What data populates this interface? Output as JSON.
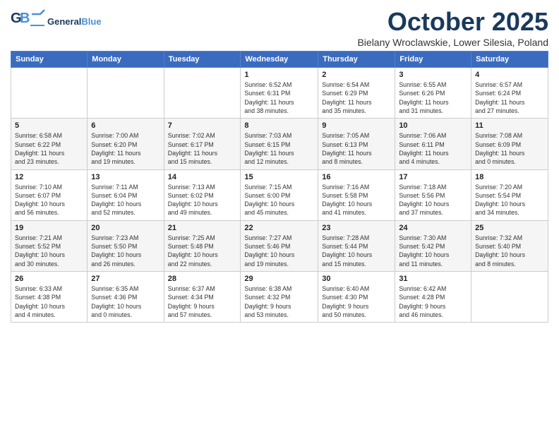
{
  "header": {
    "logo_general": "General",
    "logo_blue": "Blue",
    "month_title": "October 2025",
    "location": "Bielany Wroclawskie, Lower Silesia, Poland"
  },
  "weekdays": [
    "Sunday",
    "Monday",
    "Tuesday",
    "Wednesday",
    "Thursday",
    "Friday",
    "Saturday"
  ],
  "weeks": [
    [
      {
        "day": "",
        "detail": ""
      },
      {
        "day": "",
        "detail": ""
      },
      {
        "day": "",
        "detail": ""
      },
      {
        "day": "1",
        "detail": "Sunrise: 6:52 AM\nSunset: 6:31 PM\nDaylight: 11 hours\nand 38 minutes."
      },
      {
        "day": "2",
        "detail": "Sunrise: 6:54 AM\nSunset: 6:29 PM\nDaylight: 11 hours\nand 35 minutes."
      },
      {
        "day": "3",
        "detail": "Sunrise: 6:55 AM\nSunset: 6:26 PM\nDaylight: 11 hours\nand 31 minutes."
      },
      {
        "day": "4",
        "detail": "Sunrise: 6:57 AM\nSunset: 6:24 PM\nDaylight: 11 hours\nand 27 minutes."
      }
    ],
    [
      {
        "day": "5",
        "detail": "Sunrise: 6:58 AM\nSunset: 6:22 PM\nDaylight: 11 hours\nand 23 minutes."
      },
      {
        "day": "6",
        "detail": "Sunrise: 7:00 AM\nSunset: 6:20 PM\nDaylight: 11 hours\nand 19 minutes."
      },
      {
        "day": "7",
        "detail": "Sunrise: 7:02 AM\nSunset: 6:17 PM\nDaylight: 11 hours\nand 15 minutes."
      },
      {
        "day": "8",
        "detail": "Sunrise: 7:03 AM\nSunset: 6:15 PM\nDaylight: 11 hours\nand 12 minutes."
      },
      {
        "day": "9",
        "detail": "Sunrise: 7:05 AM\nSunset: 6:13 PM\nDaylight: 11 hours\nand 8 minutes."
      },
      {
        "day": "10",
        "detail": "Sunrise: 7:06 AM\nSunset: 6:11 PM\nDaylight: 11 hours\nand 4 minutes."
      },
      {
        "day": "11",
        "detail": "Sunrise: 7:08 AM\nSunset: 6:09 PM\nDaylight: 11 hours\nand 0 minutes."
      }
    ],
    [
      {
        "day": "12",
        "detail": "Sunrise: 7:10 AM\nSunset: 6:07 PM\nDaylight: 10 hours\nand 56 minutes."
      },
      {
        "day": "13",
        "detail": "Sunrise: 7:11 AM\nSunset: 6:04 PM\nDaylight: 10 hours\nand 52 minutes."
      },
      {
        "day": "14",
        "detail": "Sunrise: 7:13 AM\nSunset: 6:02 PM\nDaylight: 10 hours\nand 49 minutes."
      },
      {
        "day": "15",
        "detail": "Sunrise: 7:15 AM\nSunset: 6:00 PM\nDaylight: 10 hours\nand 45 minutes."
      },
      {
        "day": "16",
        "detail": "Sunrise: 7:16 AM\nSunset: 5:58 PM\nDaylight: 10 hours\nand 41 minutes."
      },
      {
        "day": "17",
        "detail": "Sunrise: 7:18 AM\nSunset: 5:56 PM\nDaylight: 10 hours\nand 37 minutes."
      },
      {
        "day": "18",
        "detail": "Sunrise: 7:20 AM\nSunset: 5:54 PM\nDaylight: 10 hours\nand 34 minutes."
      }
    ],
    [
      {
        "day": "19",
        "detail": "Sunrise: 7:21 AM\nSunset: 5:52 PM\nDaylight: 10 hours\nand 30 minutes."
      },
      {
        "day": "20",
        "detail": "Sunrise: 7:23 AM\nSunset: 5:50 PM\nDaylight: 10 hours\nand 26 minutes."
      },
      {
        "day": "21",
        "detail": "Sunrise: 7:25 AM\nSunset: 5:48 PM\nDaylight: 10 hours\nand 22 minutes."
      },
      {
        "day": "22",
        "detail": "Sunrise: 7:27 AM\nSunset: 5:46 PM\nDaylight: 10 hours\nand 19 minutes."
      },
      {
        "day": "23",
        "detail": "Sunrise: 7:28 AM\nSunset: 5:44 PM\nDaylight: 10 hours\nand 15 minutes."
      },
      {
        "day": "24",
        "detail": "Sunrise: 7:30 AM\nSunset: 5:42 PM\nDaylight: 10 hours\nand 11 minutes."
      },
      {
        "day": "25",
        "detail": "Sunrise: 7:32 AM\nSunset: 5:40 PM\nDaylight: 10 hours\nand 8 minutes."
      }
    ],
    [
      {
        "day": "26",
        "detail": "Sunrise: 6:33 AM\nSunset: 4:38 PM\nDaylight: 10 hours\nand 4 minutes."
      },
      {
        "day": "27",
        "detail": "Sunrise: 6:35 AM\nSunset: 4:36 PM\nDaylight: 10 hours\nand 0 minutes."
      },
      {
        "day": "28",
        "detail": "Sunrise: 6:37 AM\nSunset: 4:34 PM\nDaylight: 9 hours\nand 57 minutes."
      },
      {
        "day": "29",
        "detail": "Sunrise: 6:38 AM\nSunset: 4:32 PM\nDaylight: 9 hours\nand 53 minutes."
      },
      {
        "day": "30",
        "detail": "Sunrise: 6:40 AM\nSunset: 4:30 PM\nDaylight: 9 hours\nand 50 minutes."
      },
      {
        "day": "31",
        "detail": "Sunrise: 6:42 AM\nSunset: 4:28 PM\nDaylight: 9 hours\nand 46 minutes."
      },
      {
        "day": "",
        "detail": ""
      }
    ]
  ]
}
